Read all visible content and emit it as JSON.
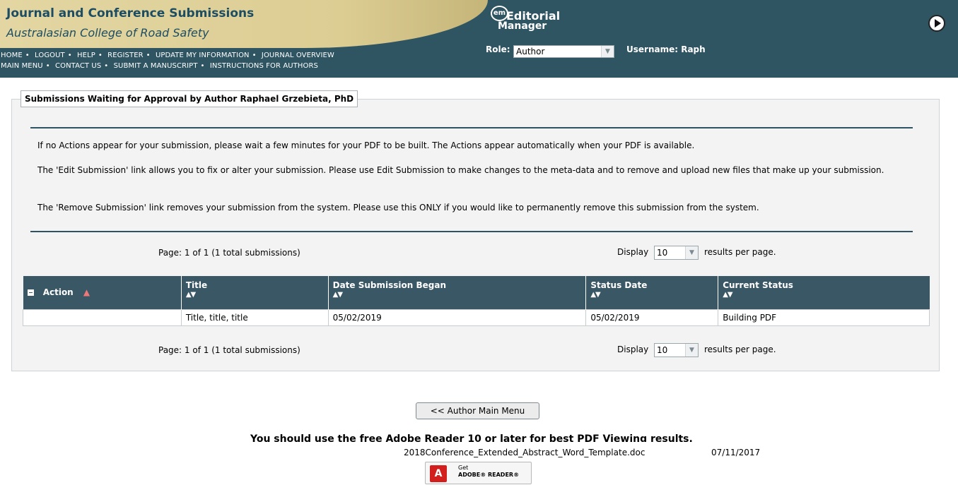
{
  "header": {
    "title": "Journal and Conference Submissions",
    "subtitle": "Australasian College of Road Safety",
    "nav_row1": [
      "HOME",
      "LOGOUT",
      "HELP",
      "REGISTER",
      "UPDATE MY INFORMATION",
      "JOURNAL OVERVIEW"
    ],
    "nav_row2": [
      "MAIN MENU",
      "CONTACT US",
      "SUBMIT A MANUSCRIPT",
      "INSTRUCTIONS FOR AUTHORS"
    ],
    "logo": {
      "badge": "em",
      "word1": "Editorial",
      "word2": "Manager"
    },
    "role_label": "Role:",
    "role_value": "Author",
    "username_text": "Username: Raph",
    "colors": {
      "bar": "#2f5563",
      "gold": "#dccd93",
      "title": "#1d4d63"
    }
  },
  "panel": {
    "legend": "Submissions Waiting for Approval by Author Raphael Grzebieta, PhD",
    "paragraphs": [
      "If no Actions appear for your submission, please wait a few minutes for your PDF to be built. The Actions appear automatically when your PDF is available.",
      "The 'Edit Submission' link allows you to fix or alter your submission. Please use Edit Submission to make changes to the meta-data and to remove and upload new files that make up your submission.",
      "The 'Remove Submission' link removes your submission from the system. Please use this ONLY if you would like to permanently remove this submission from the system."
    ],
    "pager_text": "Page: 1 of 1 (1 total submissions)",
    "display_label": "Display",
    "display_value": "10",
    "results_suffix": "results per page."
  },
  "table": {
    "headers": [
      "Action",
      "Title",
      "Date Submission Began",
      "Status Date",
      "Current Status"
    ],
    "sort_glyph": "▲▼",
    "rows": [
      {
        "action": "",
        "title": "Title, title, title",
        "date_began": "05/02/2019",
        "status_date": "05/02/2019",
        "current_status": "Building PDF"
      }
    ]
  },
  "footer": {
    "main_menu_button": "<< Author Main Menu",
    "adobe_line": "You should use the free Adobe Reader 10 or later for best PDF Viewing results.",
    "file_name": "2018Conference_Extended_Abstract_Word_Template.doc",
    "file_date": "07/11/2017",
    "adobe_badge_get": "Get",
    "adobe_badge_reader": "ADOBE® READER®"
  }
}
